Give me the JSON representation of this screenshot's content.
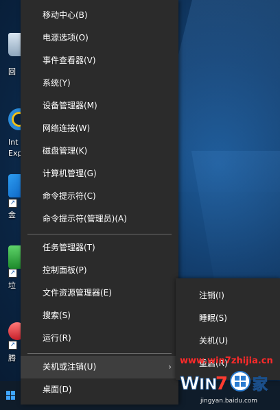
{
  "desktop": {
    "icons": [
      {
        "name": "recycle-bin",
        "label": "回"
      },
      {
        "name": "internet-explorer",
        "label": "Int\nExp"
      },
      {
        "name": "gold-app",
        "label": "金"
      },
      {
        "name": "trash-app",
        "label": "垃"
      },
      {
        "name": "tencent-app",
        "label": "腾"
      }
    ]
  },
  "menu": {
    "top_partial": "移",
    "items": [
      "移动中心(B)",
      "电源选项(O)",
      "事件查看器(V)",
      "系统(Y)",
      "设备管理器(M)",
      "网络连接(W)",
      "磁盘管理(K)",
      "计算机管理(G)",
      "命令提示符(C)",
      "命令提示符(管理员)(A)"
    ],
    "items2": [
      "任务管理器(T)",
      "控制面板(P)",
      "文件资源管理器(E)",
      "搜索(S)",
      "运行(R)"
    ],
    "shutdown": "关机或注销(U)",
    "desktop": "桌面(D)",
    "submenu_arrow": "›"
  },
  "submenu": {
    "items": [
      "注销(I)",
      "睡眠(S)",
      "关机(U)",
      "重启(R)"
    ]
  },
  "watermark": {
    "url": "www.win7zhijia.cn",
    "logo_text": "Win7之家",
    "site": "jingyan.baidu.com",
    "url_color": "#ff2a2a"
  },
  "colors": {
    "menu_bg": "#2b2b2b",
    "hover_bg": "#3e3e3e",
    "separator": "#6a6a6a",
    "accent": "#3fa5ff"
  }
}
